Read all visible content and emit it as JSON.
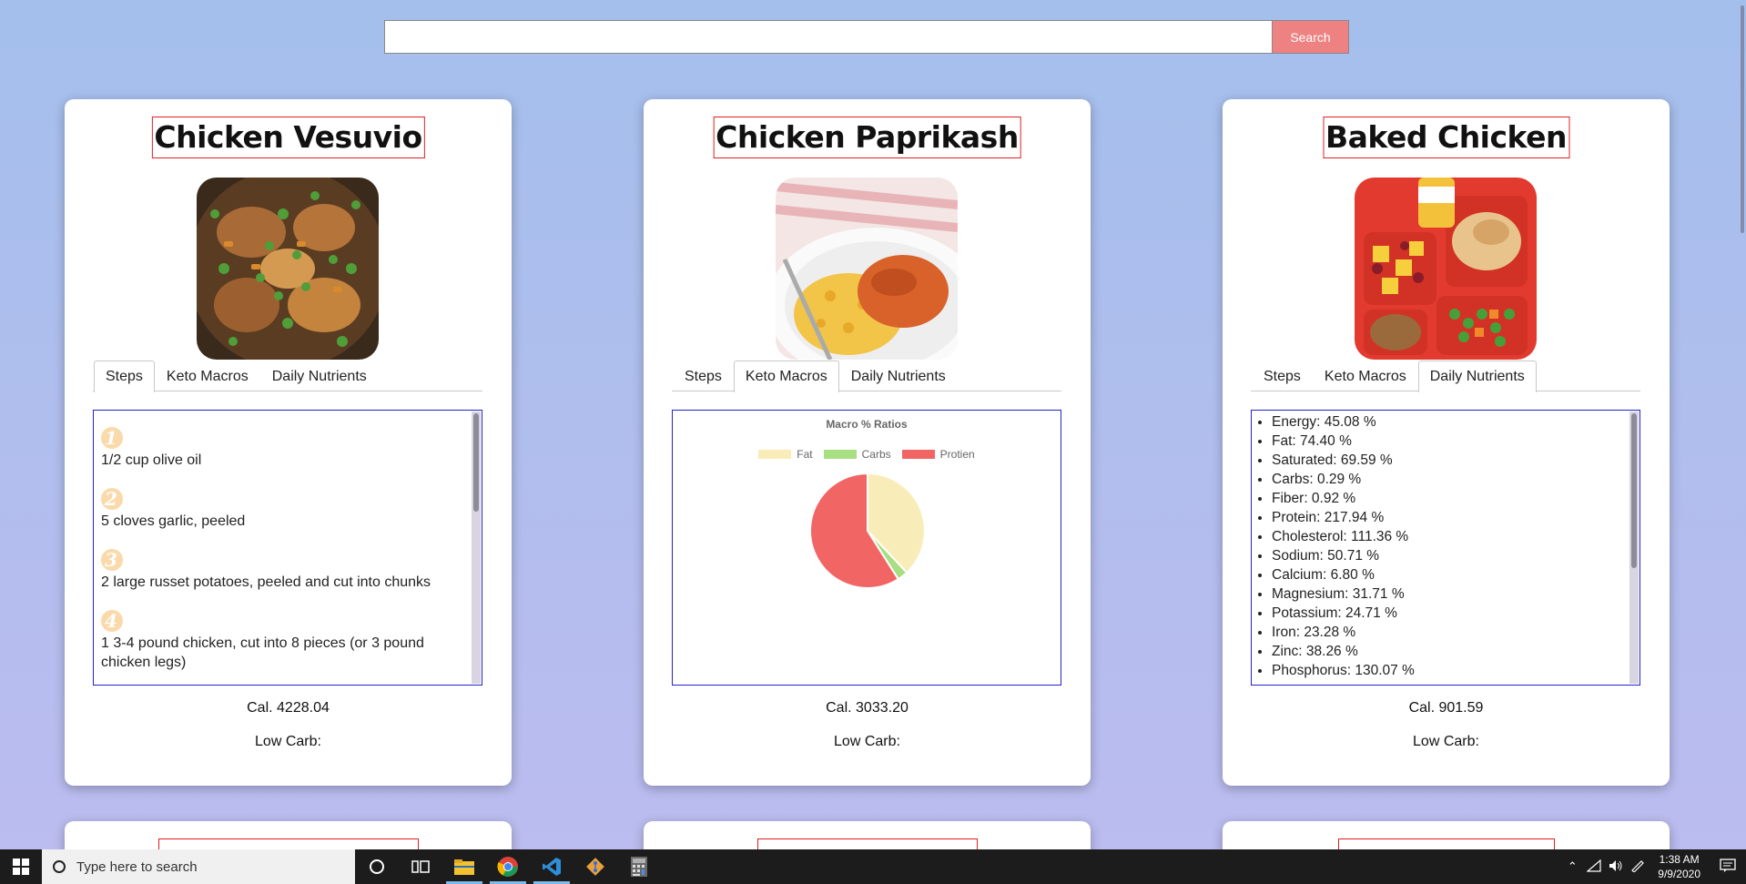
{
  "search": {
    "placeholder": "",
    "button_label": "Search"
  },
  "cards": [
    {
      "title": "Chicken Vesuvio",
      "tabs": [
        "Steps",
        "Keto Macros",
        "Daily Nutrients"
      ],
      "active_tab": "Steps",
      "steps": [
        {
          "num": "1",
          "text": "1/2 cup olive oil"
        },
        {
          "num": "2",
          "text": "5 cloves garlic, peeled"
        },
        {
          "num": "3",
          "text": "2 large russet potatoes, peeled and cut into chunks"
        },
        {
          "num": "4",
          "text": "1 3-4 pound chicken, cut into 8 pieces (or 3 pound chicken legs)"
        }
      ],
      "calories": "Cal. 4228.04",
      "low_carb": "Low Carb:"
    },
    {
      "title": "Chicken Paprikash",
      "tabs": [
        "Steps",
        "Keto Macros",
        "Daily Nutrients"
      ],
      "active_tab": "Keto Macros",
      "calories": "Cal. 3033.20",
      "low_carb": "Low Carb:"
    },
    {
      "title": "Baked Chicken",
      "tabs": [
        "Steps",
        "Keto Macros",
        "Daily Nutrients"
      ],
      "active_tab": "Daily Nutrients",
      "nutrients": [
        "Energy: 45.08 %",
        "Fat: 74.40 %",
        "Saturated: 69.59 %",
        "Carbs: 0.29 %",
        "Fiber: 0.92 %",
        "Protein: 217.94 %",
        "Cholesterol: 111.36 %",
        "Sodium: 50.71 %",
        "Calcium: 6.80 %",
        "Magnesium: 31.71 %",
        "Potassium: 24.71 %",
        "Iron: 23.28 %",
        "Zinc: 38.26 %",
        "Phosphorus: 130.07 %"
      ],
      "calories": "Cal. 901.59",
      "low_carb": "Low Carb:"
    }
  ],
  "chart_data": {
    "type": "pie",
    "title": "Macro % Ratios",
    "categories": [
      "Fat",
      "Carbs",
      "Protien"
    ],
    "values": [
      38,
      3,
      59
    ],
    "colors": [
      "#f8edb8",
      "#a8df82",
      "#f26565"
    ],
    "legend": "top"
  },
  "taskbar": {
    "search_placeholder": "Type here to search",
    "time": "1:38 AM",
    "date": "9/9/2020"
  }
}
